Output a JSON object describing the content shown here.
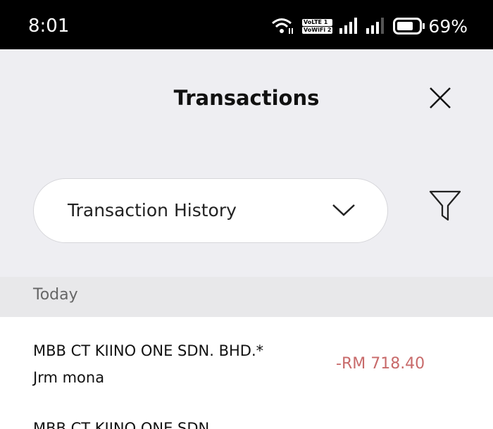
{
  "status_bar": {
    "time": "8:01",
    "volte": "VoLTE 1",
    "vowifi": "VoWiFi 2",
    "battery": "69%"
  },
  "header": {
    "title": "Transactions"
  },
  "dropdown": {
    "selected": "Transaction History"
  },
  "section": {
    "label": "Today"
  },
  "transactions": [
    {
      "name": "MBB CT KIINO ONE SDN. BHD.*",
      "detail": "Jrm mona",
      "amount": "-RM 718.40"
    },
    {
      "name": "MBB CT KIINO ONE SDN."
    }
  ],
  "colors": {
    "debit": "#c86a6a",
    "header_bg": "#eeeef2"
  }
}
